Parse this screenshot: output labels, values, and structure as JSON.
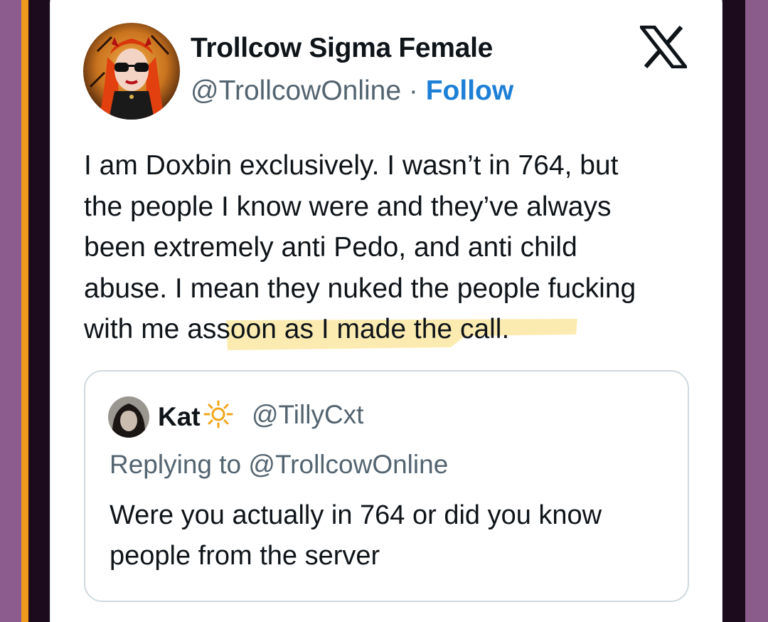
{
  "tweet": {
    "author": {
      "display_name": "Trollcow Sigma Female",
      "handle": "@TrollcowOnline",
      "separator": " · ",
      "follow_label": "Follow",
      "avatar_icon": "profile-photo-red-hair-sunglasses"
    },
    "platform_logo": "x-logo-icon",
    "text_lines": [
      "I am Doxbin exclusively. I wasn’t in 764, but",
      "the people I know were and they’ve always",
      "been extremely anti Pedo, and anti child",
      "abuse. I mean they nuked the people fucking"
    ],
    "last_line_prefix": "with me as",
    "last_line_highlighted": " soon as I made the call.",
    "highlight_color": "#fbe9a8"
  },
  "quoted_tweet": {
    "display_name": "Kat",
    "name_emoji_icon": "sun-icon",
    "handle": "@TillyCxt",
    "replying_to": "Replying to @TrollcowOnline",
    "text_lines": [
      "Were you actually in 764 or did you know",
      "people from the server"
    ]
  },
  "colors": {
    "text": "#0f1419",
    "secondary_text": "#536471",
    "link": "#1d7fd6",
    "card_border": "#cfd9de"
  }
}
